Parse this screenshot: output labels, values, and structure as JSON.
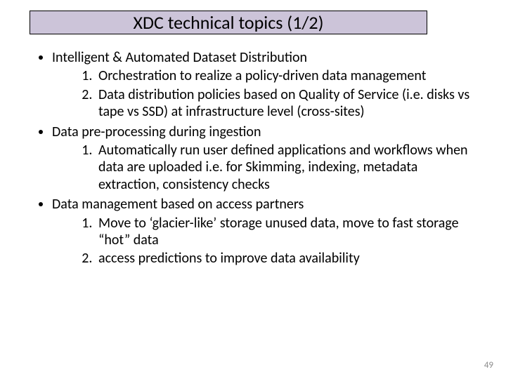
{
  "title": "XDC technical topics (1/2)",
  "bullets": [
    {
      "text": "Intelligent & Automated Dataset Distribution",
      "sub": [
        "Orchestration to realize a policy-driven data management",
        "Data distribution policies based on Quality of Service (i.e. disks vs tape vs SSD) at infrastructure level (cross-sites)"
      ]
    },
    {
      "text": "Data pre-processing during ingestion",
      "sub": [
        "Automatically run user defined applications and workflows when data are uploaded i.e. for Skimming, indexing, metadata extraction, consistency checks"
      ]
    },
    {
      "text": "Data management based on access partners",
      "sub": [
        "Move to ‘glacier-like’ storage unused data, move to fast storage “hot” data",
        "access predictions to improve data availability"
      ]
    }
  ],
  "page_number": "49"
}
